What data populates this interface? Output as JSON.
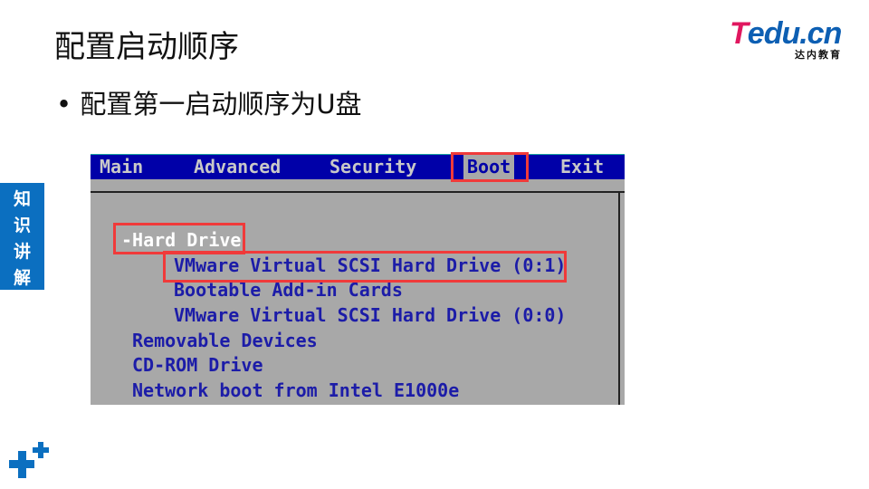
{
  "slide": {
    "title": "配置启动顺序",
    "bullet": "配置第一启动顺序为U盘",
    "side_label": [
      "知",
      "识",
      "讲",
      "解"
    ]
  },
  "logo": {
    "text_a": "T",
    "text_b": "edu.cn",
    "sub": "达内教育"
  },
  "bios": {
    "tabs": [
      "Main",
      "Advanced",
      "Security",
      "Boot",
      "Exit"
    ],
    "selected_tab": "Boot",
    "items": [
      "-Hard Drive",
      "VMware Virtual SCSI Hard Drive (0:1)",
      "Bootable Add-in Cards",
      "VMware Virtual SCSI Hard Drive (0:0)",
      "Removable Devices",
      "CD-ROM Drive",
      "Network boot from Intel E1000e"
    ],
    "colors": {
      "menubar": "#0000a8",
      "background": "#a8a8a8",
      "highlight_box": "#f03a3a"
    }
  }
}
